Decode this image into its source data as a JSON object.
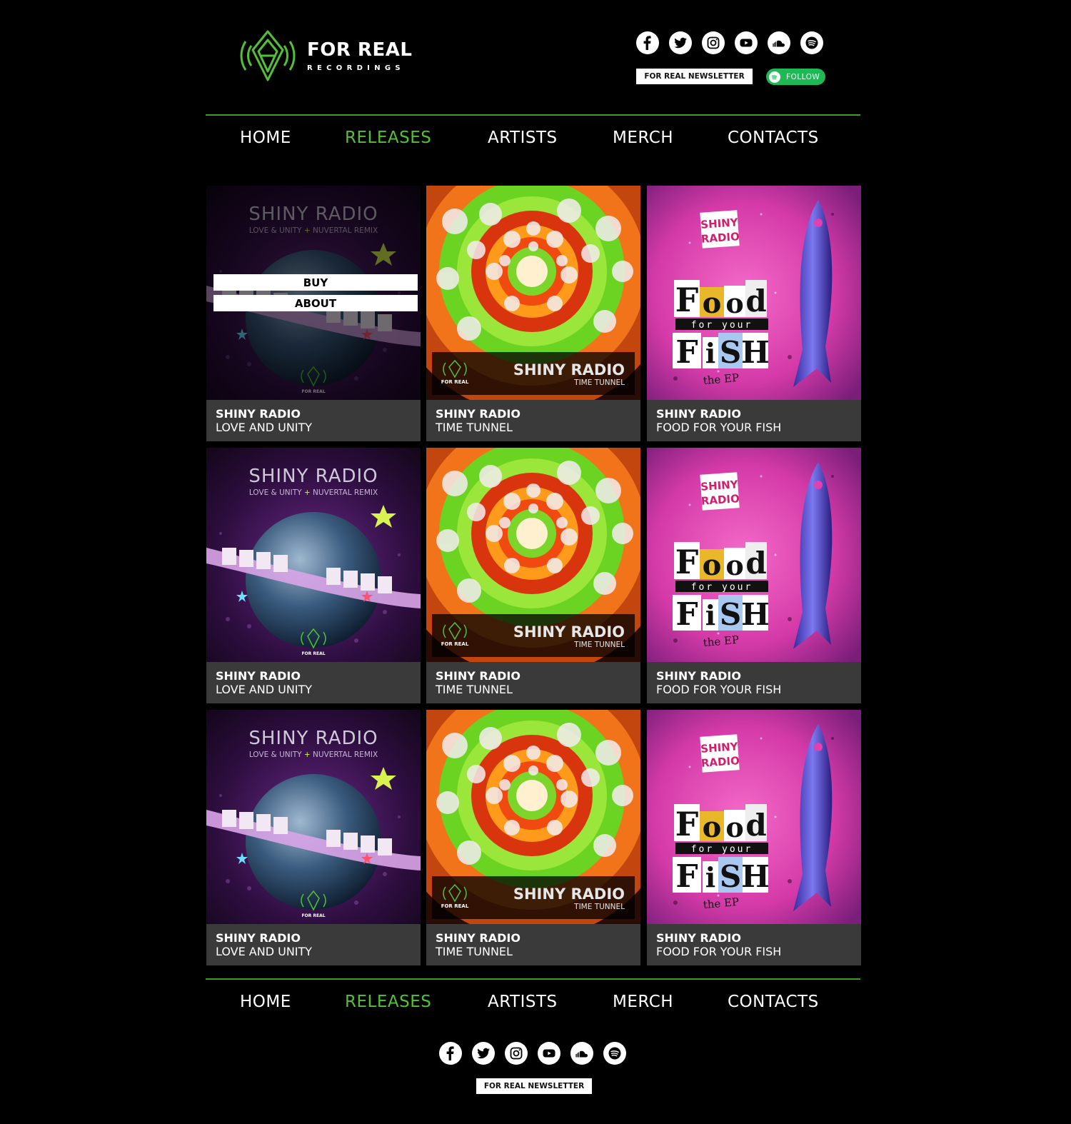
{
  "brand": {
    "title": "FOR REAL",
    "subtitle": "RECORDINGS",
    "accent": "#52c234",
    "rule_color": "#3a9c22"
  },
  "social_icons": [
    "facebook-icon",
    "twitter-icon",
    "instagram-icon",
    "youtube-icon",
    "soundcloud-icon",
    "spotify-icon"
  ],
  "header": {
    "newsletter_label": "FOR REAL NEWSLETTER",
    "follow_label": "FOLLOW"
  },
  "nav": {
    "items": [
      "HOME",
      "RELEASES",
      "ARTISTS",
      "MERCH",
      "CONTACTS"
    ],
    "active": "RELEASES"
  },
  "overlay": {
    "buy_label": "BUY",
    "about_label": "ABOUT"
  },
  "releases": [
    {
      "artist": "SHINY RADIO",
      "title": "LOVE AND UNITY",
      "cover": "love",
      "cover_title": "SHINY RADIO",
      "cover_sub": "LOVE & UNITY + NUVERTAL REMIX"
    },
    {
      "artist": "SHINY RADIO",
      "title": "TIME TUNNEL",
      "cover": "tunnel",
      "cover_title": "SHINY RADIO",
      "cover_sub": "TIME TUNNEL"
    },
    {
      "artist": "SHINY RADIO",
      "title": "FOOD FOR YOUR FISH",
      "cover": "fish",
      "cover_title": "Food for your FiSH",
      "cover_sub": "the EP"
    },
    {
      "artist": "SHINY RADIO",
      "title": "LOVE AND UNITY",
      "cover": "love",
      "cover_title": "SHINY RADIO",
      "cover_sub": "LOVE & UNITY + NUVERTAL REMIX"
    },
    {
      "artist": "SHINY RADIO",
      "title": "TIME TUNNEL",
      "cover": "tunnel",
      "cover_title": "SHINY RADIO",
      "cover_sub": "TIME TUNNEL"
    },
    {
      "artist": "SHINY RADIO",
      "title": "FOOD FOR YOUR FISH",
      "cover": "fish",
      "cover_title": "Food for your FiSH",
      "cover_sub": "the EP"
    },
    {
      "artist": "SHINY RADIO",
      "title": "LOVE AND UNITY",
      "cover": "love",
      "cover_title": "SHINY RADIO",
      "cover_sub": "LOVE & UNITY + NUVERTAL REMIX"
    },
    {
      "artist": "SHINY RADIO",
      "title": "TIME TUNNEL",
      "cover": "tunnel",
      "cover_title": "SHINY RADIO",
      "cover_sub": "TIME TUNNEL"
    },
    {
      "artist": "SHINY RADIO",
      "title": "FOOD FOR YOUR FISH",
      "cover": "fish",
      "cover_title": "Food for your FiSH",
      "cover_sub": "the EP"
    }
  ],
  "footer": {
    "newsletter_label": "FOR REAL NEWSLETTER"
  }
}
